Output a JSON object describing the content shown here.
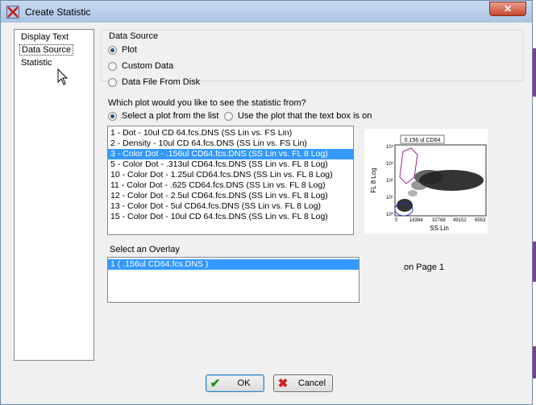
{
  "window": {
    "title": "Create Statistic",
    "close_glyph": "✕"
  },
  "nav": {
    "items": [
      "Display Text",
      "Data Source",
      "Statistic"
    ],
    "selected": "Data Source"
  },
  "data_source": {
    "group_title": "Data Source",
    "options": [
      {
        "label": "Plot",
        "checked": true
      },
      {
        "label": "Custom Data",
        "checked": false
      },
      {
        "label": "Data File From Disk",
        "checked": false
      }
    ]
  },
  "plot_question": "Which plot would you like to see the statistic from?",
  "plot_mode": [
    {
      "label": "Select a plot from the list",
      "checked": true
    },
    {
      "label": "Use the plot that the text box is on",
      "checked": false
    }
  ],
  "plot_list": {
    "items": [
      "1 - Dot - 10ul CD 64.fcs.DNS (SS Lin vs. FS Lin)",
      "2 - Density - 10ul CD 64.fcs.DNS (SS Lin vs. FS Lin)",
      "3 - Color Dot - .156ul CD64.fcs.DNS (SS Lin vs. FL 8 Log)",
      "5 - Color Dot - .313ul CD64.fcs.DNS (SS Lin vs. FL 8 Log)",
      "10 - Color Dot - 1.25ul CD64.fcs.DNS (SS Lin vs. FL 8 Log)",
      "11 - Color Dot - .625 CD64.fcs.DNS (SS Lin vs. FL 8 Log)",
      "12 - Color Dot - 2.5ul CD64.fcs.DNS (SS Lin vs. FL 8 Log)",
      "13 - Color Dot - 5ul CD64.fcs.DNS (SS Lin vs. FL 8 Log)",
      "15 - Color Dot - 10ul CD 64.fcs.DNS (SS Lin vs. FL 8 Log)"
    ],
    "selected_index": 2
  },
  "preview": {
    "title": "0.156 ul CD64",
    "xlabel": "SS Lin",
    "ylabel": "FL 8 Log",
    "xticks": [
      "0",
      "16384",
      "32768",
      "49152",
      "6553"
    ],
    "yticks": [
      "10⁴",
      "10³",
      "10²",
      "10¹",
      "10⁰"
    ]
  },
  "overlay": {
    "label": "Select an Overlay",
    "items": [
      "1 ( .156ul CD64.fcs.DNS )"
    ],
    "selected_index": 0
  },
  "page_note": "on Page 1",
  "buttons": {
    "ok": {
      "label": "OK",
      "icon": "✔",
      "color": "#1a8f1a"
    },
    "cancel": {
      "label": "Cancel",
      "icon": "✖",
      "color": "#d02020"
    }
  }
}
